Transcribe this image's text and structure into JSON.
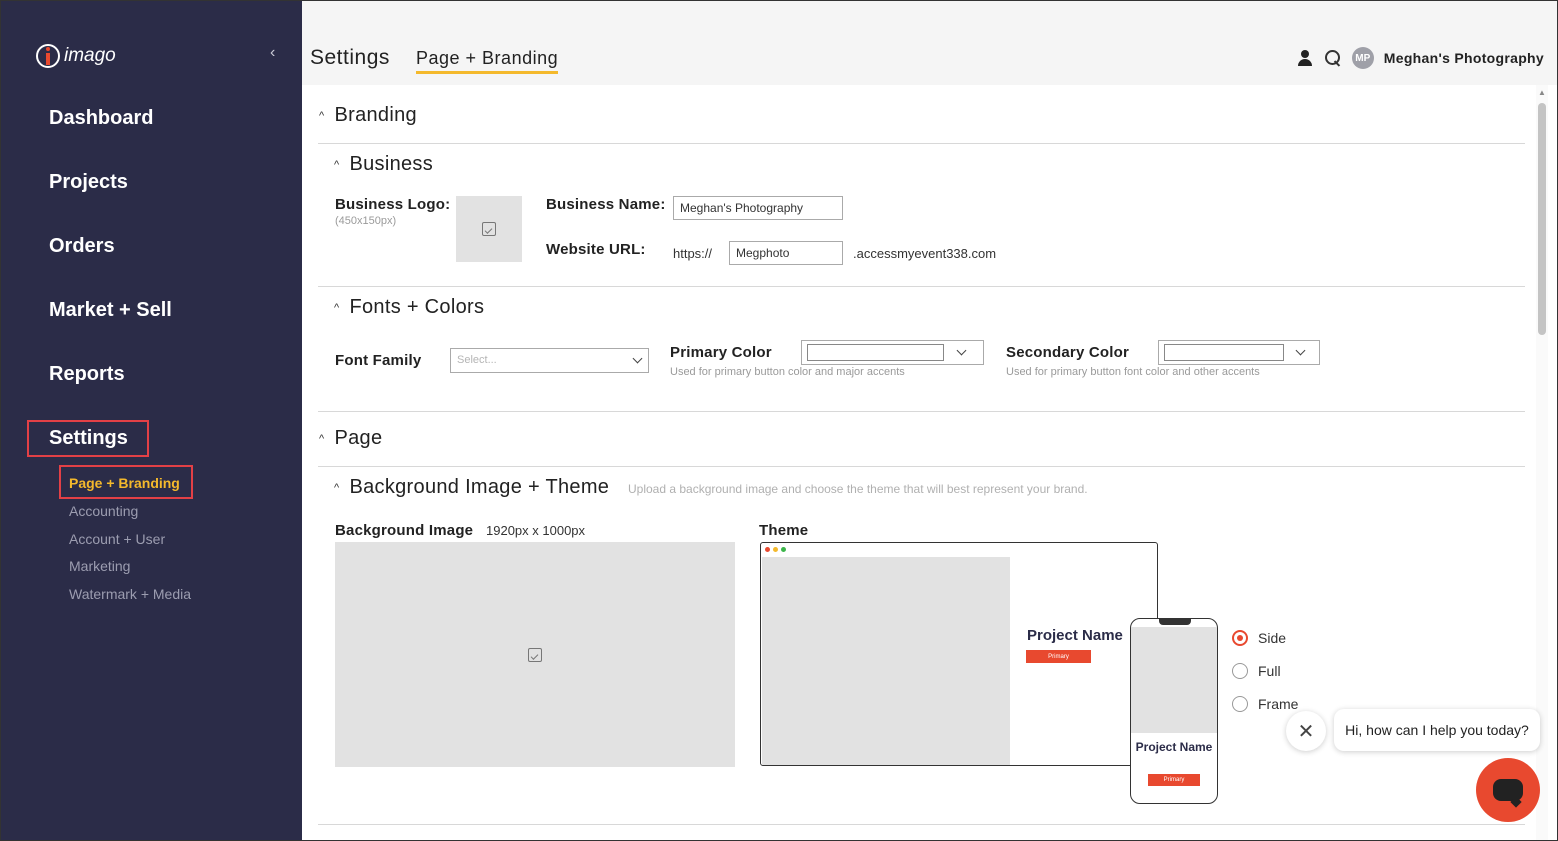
{
  "sidebar": {
    "logo_text": "imago",
    "collapse_icon": "chevron-left-icon",
    "nav": [
      "Dashboard",
      "Projects",
      "Orders",
      "Market + Sell",
      "Reports",
      "Settings"
    ],
    "settings_sub": [
      "Page + Branding",
      "Accounting",
      "Account + User",
      "Marketing",
      "Watermark + Media"
    ]
  },
  "header": {
    "title": "Settings",
    "active_tab": "Page + Branding",
    "avatar_initials": "MP",
    "business_name": "Meghan's Photography"
  },
  "branding": {
    "title": "Branding",
    "business": {
      "title": "Business",
      "logo_label": "Business Logo:",
      "logo_hint": "(450x150px)",
      "name_label": "Business Name:",
      "name_value": "Meghan's Photography",
      "url_label": "Website URL:",
      "url_prefix": "https://",
      "url_value": "Megphoto",
      "url_suffix": ".accessmyevent338.com"
    },
    "fonts": {
      "title": "Fonts + Colors",
      "font_family_label": "Font Family",
      "font_placeholder": "Select...",
      "primary_label": "Primary Color",
      "primary_hint": "Used for primary button color and major accents",
      "secondary_label": "Secondary Color",
      "secondary_hint": "Used for primary button font color and other accents"
    }
  },
  "page": {
    "title": "Page",
    "bg": {
      "title": "Background Image + Theme",
      "hint": "Upload a background image and choose the theme that will best represent your brand.",
      "image_label": "Background Image",
      "image_size": "1920px x 1000px",
      "theme_label": "Theme",
      "preview_project_name": "Project Name",
      "preview_phone_name": "Project Name",
      "preview_button": "Primary",
      "theme_options": [
        "Side",
        "Full",
        "Frame"
      ],
      "selected_theme": "Side"
    }
  },
  "chat": {
    "message": "Hi, how can I help you today?",
    "close_symbol": "✕"
  },
  "colors": {
    "sidebar_bg": "#2b2c48",
    "accent_yellow": "#f4b92c",
    "accent_red": "#e8492f",
    "highlight_box": "#e34046"
  }
}
